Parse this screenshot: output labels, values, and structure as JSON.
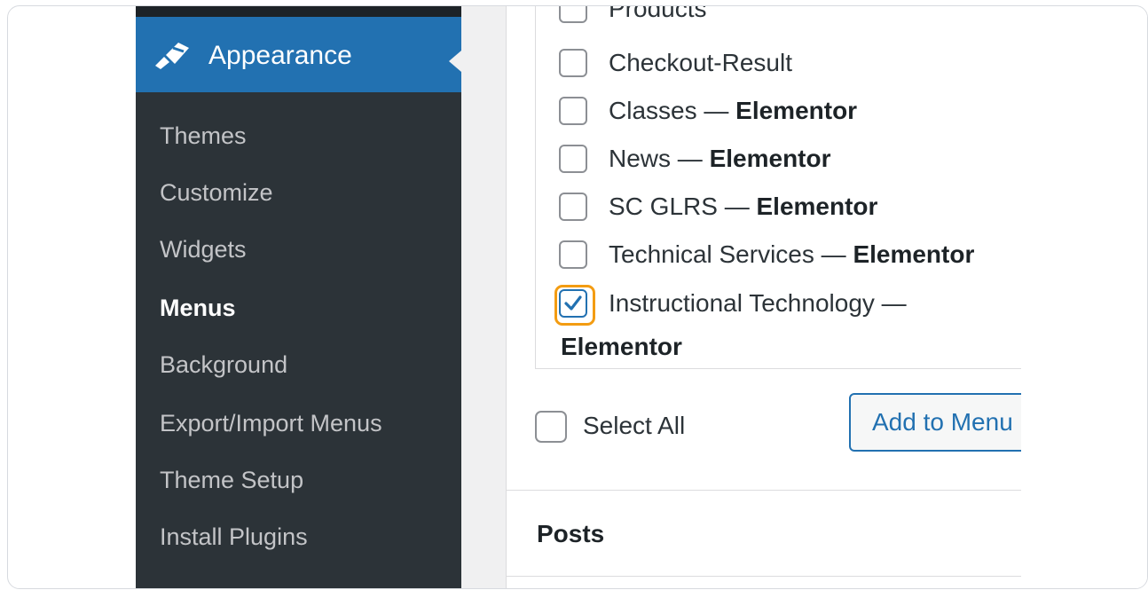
{
  "sidebar": {
    "section": {
      "label": "Appearance",
      "icon": "paintbrush-icon"
    },
    "items": [
      {
        "label": "Themes",
        "active": false
      },
      {
        "label": "Customize",
        "active": false
      },
      {
        "label": "Widgets",
        "active": false
      },
      {
        "label": "Menus",
        "active": true
      },
      {
        "label": "Background",
        "active": false
      },
      {
        "label": "Export/Import Menus",
        "active": false
      },
      {
        "label": "Theme Setup",
        "active": false
      },
      {
        "label": "Install Plugins",
        "active": false
      }
    ]
  },
  "pages_list": {
    "items": [
      {
        "name": "Products",
        "suffix": "",
        "checked": false
      },
      {
        "name": "Checkout-Result",
        "suffix": "",
        "checked": false
      },
      {
        "name": "Classes — ",
        "suffix": "Elementor",
        "checked": false
      },
      {
        "name": "News — ",
        "suffix": "Elementor",
        "checked": false
      },
      {
        "name": "SC GLRS — ",
        "suffix": "Elementor",
        "checked": false
      },
      {
        "name": "Technical Services — ",
        "suffix": "Elementor",
        "checked": false
      },
      {
        "name": "Instructional Technology —",
        "suffix": "Elementor",
        "checked": true
      }
    ],
    "select_all_label": "Select All",
    "add_button_label": "Add to Menu"
  },
  "sections": {
    "posts_label": "Posts"
  },
  "colors": {
    "accent": "#2271b1",
    "sidebar_bg": "#2c3338",
    "focus": "#f39c12"
  }
}
